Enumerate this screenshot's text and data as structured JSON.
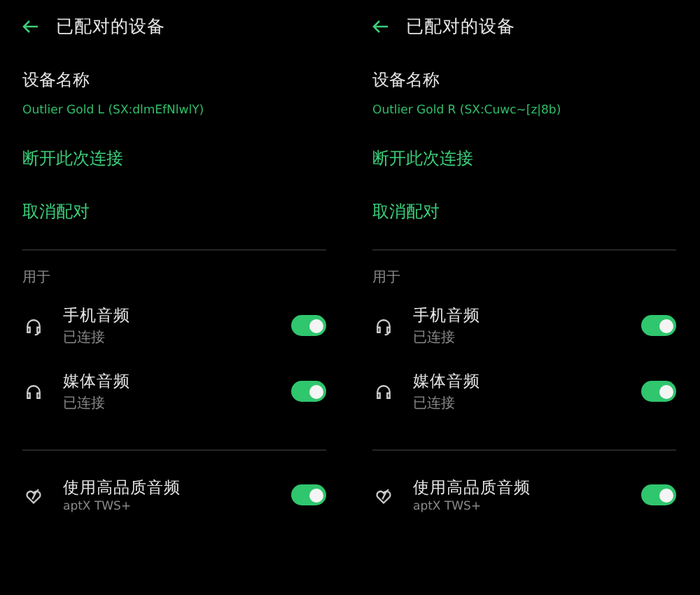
{
  "panels": [
    {
      "title": "已配对的设备",
      "device_name_label": "设备名称",
      "device_name": "Outlier Gold L (SX:dlmEfNlwlY)",
      "actions": [
        "断开此次连接",
        "取消配对"
      ],
      "section_label": "用于",
      "profiles": [
        {
          "title": "手机音频",
          "subtitle": "已连接",
          "on": true
        },
        {
          "title": "媒体音频",
          "subtitle": "已连接",
          "on": true
        }
      ],
      "quality": {
        "title": "使用高品质音频",
        "subtitle": "aptX TWS+",
        "on": true
      }
    },
    {
      "title": "已配对的设备",
      "device_name_label": "设备名称",
      "device_name": "Outlier Gold R (SX:Cuwc~[z|8b)",
      "actions": [
        "断开此次连接",
        "取消配对"
      ],
      "section_label": "用于",
      "profiles": [
        {
          "title": "手机音频",
          "subtitle": "已连接",
          "on": true
        },
        {
          "title": "媒体音频",
          "subtitle": "已连接",
          "on": true
        }
      ],
      "quality": {
        "title": "使用高品质音频",
        "subtitle": "aptX TWS+",
        "on": true
      }
    }
  ]
}
